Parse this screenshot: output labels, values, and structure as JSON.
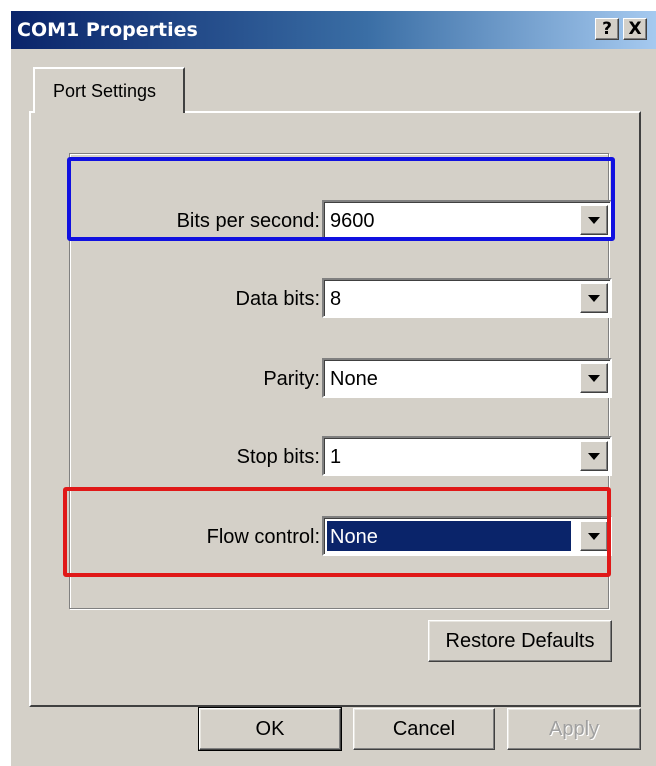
{
  "window": {
    "title": "COM1 Properties",
    "help_label": "?",
    "close_label": "X"
  },
  "tabs": [
    {
      "label": "Port Settings",
      "active": true
    }
  ],
  "fields": {
    "bits_per_second": {
      "label": "Bits per second:",
      "value": "9600"
    },
    "data_bits": {
      "label": "Data bits:",
      "value": "8"
    },
    "parity": {
      "label": "Parity:",
      "value": "None"
    },
    "stop_bits": {
      "label": "Stop bits:",
      "value": "1"
    },
    "flow_control": {
      "label": "Flow control:",
      "value": "None",
      "selected": true
    }
  },
  "buttons": {
    "restore_defaults": "Restore Defaults",
    "ok": "OK",
    "cancel": "Cancel",
    "apply": "Apply"
  },
  "highlights": {
    "bits_per_second_color": "#1010e0",
    "flow_control_color": "#e01818"
  },
  "colors": {
    "face": "#d4d0c8",
    "title_start": "#0a246a",
    "title_end": "#a6caf0",
    "selection": "#0a246a"
  }
}
